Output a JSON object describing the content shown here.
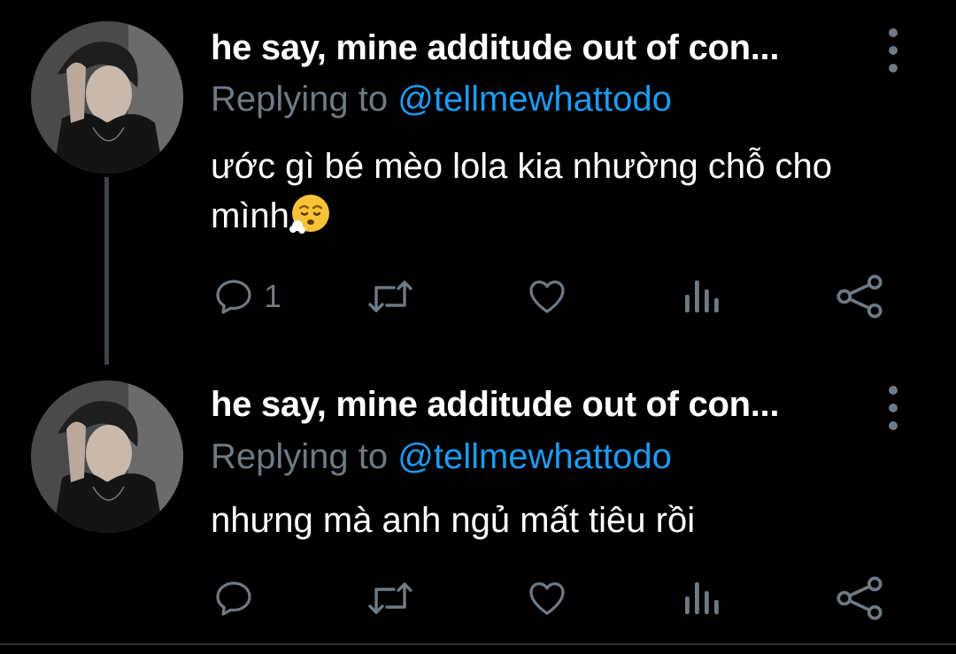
{
  "tweets": [
    {
      "author_name": "he say, mine additude out of con...",
      "replying_prefix": "Replying to ",
      "replying_handle": "@tellmewhattodo",
      "text": "ước gì bé mèo lola kia nhường chỗ cho mình",
      "emoji": "face-exhaling-emoji",
      "reply_count": "1"
    },
    {
      "author_name": "he say, mine additude out of con...",
      "replying_prefix": "Replying to ",
      "replying_handle": "@tellmewhattodo",
      "text": "nhưng mà anh ngủ mất tiêu rồi",
      "reply_count": ""
    }
  ],
  "icons": {
    "reply": "reply-icon",
    "retweet": "retweet-icon",
    "like": "heart-icon",
    "views": "views-icon",
    "share": "share-icon",
    "more": "more-vertical-icon"
  },
  "colors": {
    "background": "#000000",
    "text_primary": "#ffffff",
    "text_secondary": "#6e7a84",
    "link": "#1d9bf0",
    "thread_line": "#3d4449"
  }
}
